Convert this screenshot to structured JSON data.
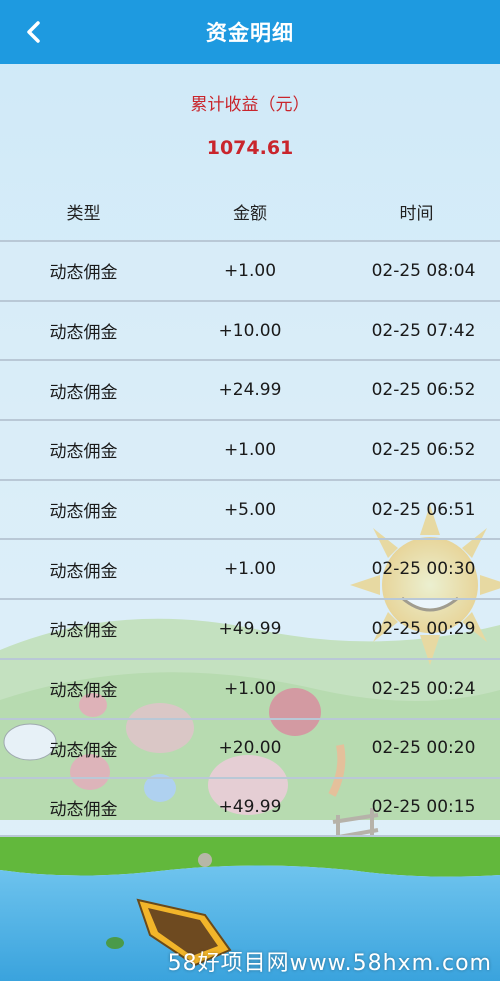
{
  "header": {
    "title": "资金明细",
    "back_icon": "chevron-left-icon"
  },
  "summary": {
    "label": "累计收益（元）",
    "value": "1074.61",
    "accent_color": "#c9252c"
  },
  "table": {
    "columns": [
      "类型",
      "金额",
      "时间"
    ],
    "rows": [
      {
        "type": "动态佣金",
        "amount": "+1.00",
        "time": "02-25 08:04"
      },
      {
        "type": "动态佣金",
        "amount": "+10.00",
        "time": "02-25 07:42"
      },
      {
        "type": "动态佣金",
        "amount": "+24.99",
        "time": "02-25 06:52"
      },
      {
        "type": "动态佣金",
        "amount": "+1.00",
        "time": "02-25 06:52"
      },
      {
        "type": "动态佣金",
        "amount": "+5.00",
        "time": "02-25 06:51"
      },
      {
        "type": "动态佣金",
        "amount": "+1.00",
        "time": "02-25 00:30"
      },
      {
        "type": "动态佣金",
        "amount": "+49.99",
        "time": "02-25 00:29"
      },
      {
        "type": "动态佣金",
        "amount": "+1.00",
        "time": "02-25 00:24"
      },
      {
        "type": "动态佣金",
        "amount": "+20.00",
        "time": "02-25 00:20"
      },
      {
        "type": "动态佣金",
        "amount": "+49.99",
        "time": "02-25 00:15"
      }
    ]
  },
  "watermark": "58好项目网www.58hxm.com",
  "colors": {
    "header_bg": "#1e9ae0",
    "accent": "#c9252c"
  }
}
